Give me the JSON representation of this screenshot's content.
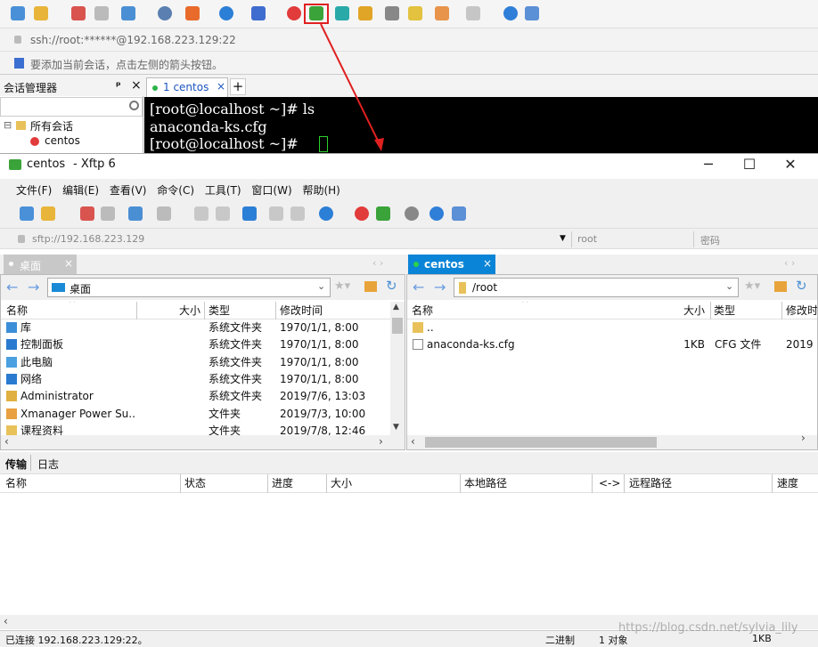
{
  "bg_app": {
    "address": "ssh://root:******@192.168.223.129:22",
    "hint": "要添加当前会话，点击左侧的箭头按钮。",
    "session_mgr_title": "会话管理器",
    "pin": "ᵖ",
    "close": "×",
    "search_icon": "search-icon",
    "tree": {
      "root": "所有会话",
      "item": "centos",
      "expand": "⊟"
    },
    "tab": {
      "label": "1 centos",
      "close": "×",
      "add": "+"
    },
    "terminal_lines": [
      "[root@localhost ~]# ls",
      "anaconda-ks.cfg",
      "[root@localhost ~]# "
    ]
  },
  "xftp": {
    "title_app": "centos",
    "title_suffix": "- Xftp 6",
    "win_buttons": [
      "─",
      "☐",
      "✕"
    ],
    "menu": [
      "文件(F)",
      "编辑(E)",
      "查看(V)",
      "命令(C)",
      "工具(T)",
      "窗口(W)",
      "帮助(H)"
    ],
    "address": {
      "url": "sftp://192.168.223.129",
      "user": "root",
      "password_placeholder": "密码"
    },
    "left_tab": {
      "label": "桌面",
      "close": "×"
    },
    "right_tab": {
      "label": "centos",
      "close": "×"
    },
    "left_path": "桌面",
    "right_path": "/root",
    "left_cols": [
      "名称",
      "大小",
      "类型",
      "修改时间"
    ],
    "right_cols": [
      "名称",
      "大小",
      "类型",
      "修改时"
    ],
    "left_rows": [
      {
        "name": "库",
        "size": "",
        "type": "系统文件夹",
        "date": "1970/1/1, 8:00",
        "icon": "library-icon"
      },
      {
        "name": "控制面板",
        "size": "",
        "type": "系统文件夹",
        "date": "1970/1/1, 8:00",
        "icon": "control-panel-icon"
      },
      {
        "name": "此电脑",
        "size": "",
        "type": "系统文件夹",
        "date": "1970/1/1, 8:00",
        "icon": "computer-icon"
      },
      {
        "name": "网络",
        "size": "",
        "type": "系统文件夹",
        "date": "1970/1/1, 8:00",
        "icon": "network-icon"
      },
      {
        "name": "Administrator",
        "size": "",
        "type": "系统文件夹",
        "date": "2019/7/6, 13:03",
        "icon": "user-folder-icon"
      },
      {
        "name": "Xmanager Power Su...",
        "size": "",
        "type": "文件夹",
        "date": "2019/7/3, 10:00",
        "icon": "xmanager-icon"
      },
      {
        "name": "课程资料",
        "size": "",
        "type": "文件夹",
        "date": "2019/7/8, 12:46",
        "icon": "folder-icon"
      }
    ],
    "right_rows": [
      {
        "name": "..",
        "size": "",
        "type": "",
        "date": "",
        "icon": "folder-up-icon"
      },
      {
        "name": "anaconda-ks.cfg",
        "size": "1KB",
        "type": "CFG 文件",
        "date": "2019",
        "icon": "file-icon"
      }
    ],
    "bottom_tabs": [
      "传输",
      "日志"
    ],
    "transfer_cols": [
      "名称",
      "状态",
      "进度",
      "大小",
      "本地路径",
      "<->",
      "远程路径",
      "速度"
    ],
    "status": {
      "left": "已连接 192.168.223.129:22。",
      "mode": "二进制",
      "count": "1 对象",
      "size": "1KB"
    },
    "watermark": "https://blog.csdn.net/sylvia_lily"
  },
  "colors": {
    "accent": "#0a84d6",
    "terminal_bg": "#000000",
    "arrow": "#e02020",
    "highlight": "#e02020"
  }
}
